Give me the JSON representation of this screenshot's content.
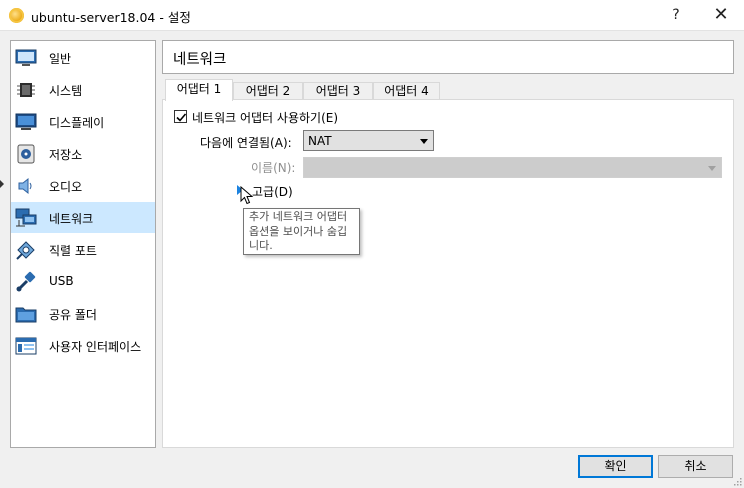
{
  "window": {
    "title": "ubuntu-server18.04 - 설정",
    "help": "?",
    "close": "✕"
  },
  "sidebar": {
    "items": [
      {
        "label": "일반",
        "icon": "general-icon"
      },
      {
        "label": "시스템",
        "icon": "system-icon"
      },
      {
        "label": "디스플레이",
        "icon": "display-icon"
      },
      {
        "label": "저장소",
        "icon": "storage-icon"
      },
      {
        "label": "오디오",
        "icon": "audio-icon"
      },
      {
        "label": "네트워크",
        "icon": "network-icon",
        "selected": true
      },
      {
        "label": "직렬 포트",
        "icon": "serial-port-icon"
      },
      {
        "label": "USB",
        "icon": "usb-icon"
      },
      {
        "label": "공유 폴더",
        "icon": "shared-folder-icon"
      },
      {
        "label": "사용자 인터페이스",
        "icon": "user-interface-icon"
      }
    ]
  },
  "main": {
    "title": "네트워크",
    "tabs": [
      {
        "label": "어댑터 1",
        "active": true
      },
      {
        "label": "어댑터 2"
      },
      {
        "label": "어댑터 3"
      },
      {
        "label": "어댑터 4"
      }
    ],
    "enable_adapter": {
      "label": "네트워크 어댑터 사용하기(E)",
      "checked": true
    },
    "attached_to": {
      "label": "다음에 연결됨(A):",
      "value": "NAT"
    },
    "name": {
      "label": "이름(N):",
      "value": "",
      "disabled": true
    },
    "advanced": {
      "label": "고급(D)",
      "expanded": false
    },
    "tooltip": "추가 네트워크 어댑터 옵션을 보이거나 숨깁니다."
  },
  "buttons": {
    "ok": "확인",
    "cancel": "취소"
  },
  "colors": {
    "selection": "#cce8ff",
    "accent": "#0078d7",
    "arrow": "#1c83e0"
  }
}
